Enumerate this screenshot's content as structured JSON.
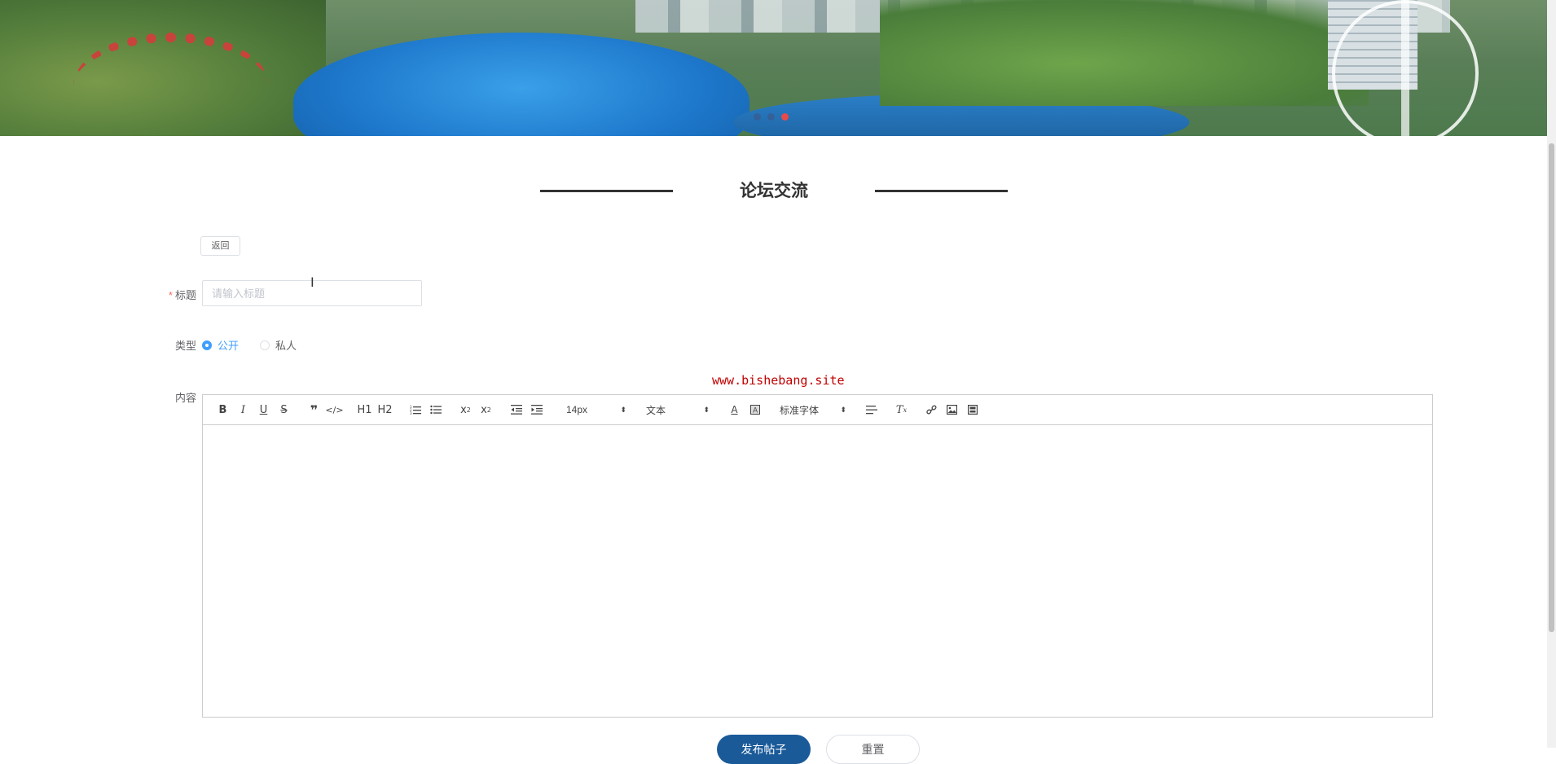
{
  "section": {
    "title": "论坛交流"
  },
  "actions": {
    "back_label": "返回",
    "submit_label": "发布帖子",
    "reset_label": "重置"
  },
  "form": {
    "title_label": "标题",
    "title_required_mark": "*",
    "title_placeholder": "请输入标题",
    "title_value": "",
    "type_label": "类型",
    "type_options": [
      "公开",
      "私人"
    ],
    "type_selected": "公开",
    "content_label": "内容"
  },
  "watermark": "www.bishebang.site",
  "editor": {
    "font_size": "14px",
    "block_format": "文本",
    "font_family": "标准字体",
    "header1": "H1",
    "header2": "H2"
  },
  "colors": {
    "accent": "#409eff",
    "primary_button": "#1a5a99",
    "watermark": "#c00000",
    "required": "#f56c6c"
  }
}
